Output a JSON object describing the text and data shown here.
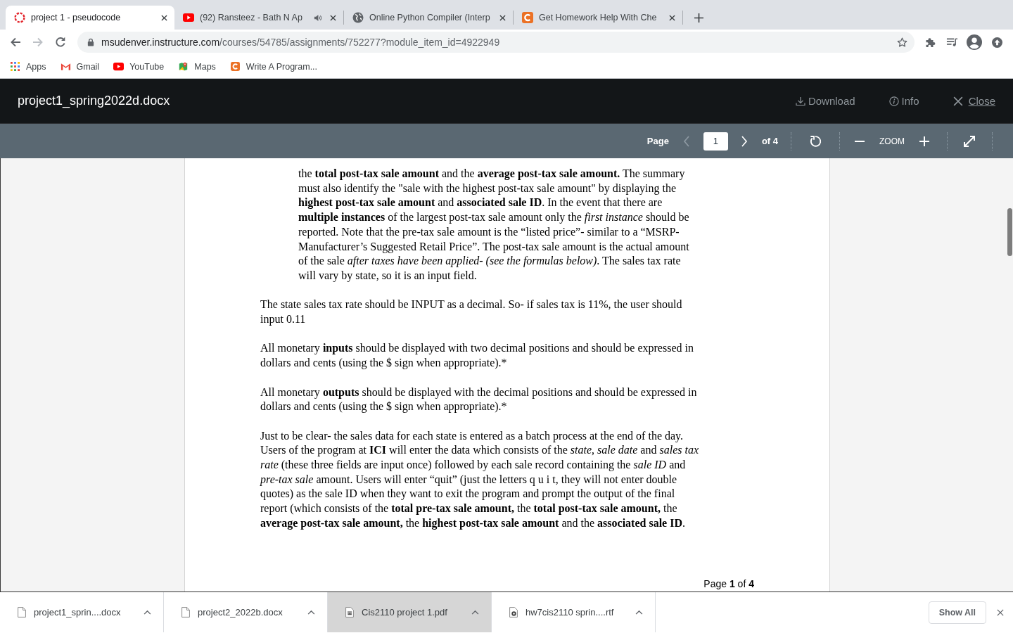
{
  "browser": {
    "tabs": [
      {
        "title": "project 1 - pseudocode",
        "kind": "ring",
        "selected": true,
        "playing_audio": false
      },
      {
        "title": "(92) Ransteez - Bath N Ap",
        "kind": "video",
        "selected": false,
        "playing_audio": true
      },
      {
        "title": "Online Python Compiler (Interp",
        "kind": "globe",
        "selected": false,
        "playing_audio": false
      },
      {
        "title": "Get Homework Help With Che",
        "kind": "letter",
        "selected": false,
        "playing_audio": false
      }
    ],
    "navigation": {
      "back_disabled": false,
      "forward_disabled": true
    },
    "address_bar": {
      "host": "msudenver.instructure.com",
      "path": "/courses/54785/assignments/752277?module_item_id=4922949"
    },
    "bookmarks": [
      {
        "label": "Apps",
        "kind": "grid"
      },
      {
        "label": "Gmail",
        "kind": "mail"
      },
      {
        "label": "YouTube",
        "kind": "video"
      },
      {
        "label": "Maps",
        "kind": "map"
      },
      {
        "label": "Write A Program...",
        "kind": "letter"
      }
    ]
  },
  "viewer": {
    "file_name": "project1_spring2022d.docx",
    "actions": [
      {
        "label": "Download",
        "kind": "download"
      },
      {
        "label": "Info",
        "kind": "info"
      },
      {
        "label": "Close",
        "kind": "close"
      }
    ],
    "toolbar": {
      "page_label": "Page",
      "page_value": "1",
      "page_total": "of 4",
      "previous_disabled": true,
      "next_disabled": false,
      "zoom_label": "ZOOM"
    }
  },
  "document": {
    "paragraphs": [
      {
        "kind": "indented",
        "lines": [
          "the **total post-tax sale amount** and the **average post-tax sale amount.**  The summary",
          "must also identify the \"sale with the highest post-tax sale amount\" by displaying the",
          "**highest post-tax sale amount** and **associated sale ID**. In the event that there are",
          "**multiple instances** of the largest post-tax sale amount only the *first instance* should be",
          "reported.  Note that the pre-tax sale amount is the “listed price”- similar to a “MSRP-",
          "Manufacturer’s Suggested Retail Price”.  The post-tax sale amount is the actual amount",
          "of the sale *after taxes have been applied- (see the formulas below)*.  The sales tax rate",
          "will vary by state, so it is an input field."
        ]
      },
      {
        "kind": "plain",
        "lines": [
          "The state sales tax rate should be INPUT as a decimal.  So- if sales tax is 11%, the user should",
          "input 0.11"
        ]
      },
      {
        "kind": "plain",
        "lines": [
          "All monetary **inputs** should be displayed with two decimal positions and should be expressed in",
          "dollars and cents (using the $ sign when appropriate).*"
        ]
      },
      {
        "kind": "plain",
        "lines": [
          "All monetary **outputs** should be displayed with the decimal positions and should be expressed in",
          "dollars and cents (using the $ sign when appropriate).*"
        ]
      },
      {
        "kind": "plain",
        "lines": [
          "Just to be clear- the sales data  for each state is entered as a batch process at the end of the day.",
          "Users of the program at **ICI** will enter the data which consists of the *state*, *sale date* and *sales tax*",
          "*rate* (these three fields are input once) followed by each sale record containing the *sale ID* and",
          "*pre-tax sale* amount.  Users will enter “quit” (just the letters q u i t, they will not enter double",
          "quotes) as the sale ID when they want to exit the program and prompt the output of the final",
          "report (which consists of the **total pre-tax sale amount,** the **total post-tax sale amount,** the",
          "**average post-tax sale amount,** the **highest post-tax sale amount** and the **associated sale ID**."
        ]
      }
    ],
    "page_footer": "Page **1** of **4**"
  },
  "downloads": {
    "items": [
      {
        "name": "project1_sprin....docx",
        "kind": "plain",
        "selected": false
      },
      {
        "name": "project2_2022b.docx",
        "kind": "plain",
        "selected": false
      },
      {
        "name": "Cis2110 project 1.pdf",
        "kind": "picture",
        "selected": true
      },
      {
        "name": "hw7cis2110 sprin....rtf",
        "kind": "badge",
        "selected": false
      }
    ],
    "show_all": "Show All"
  }
}
